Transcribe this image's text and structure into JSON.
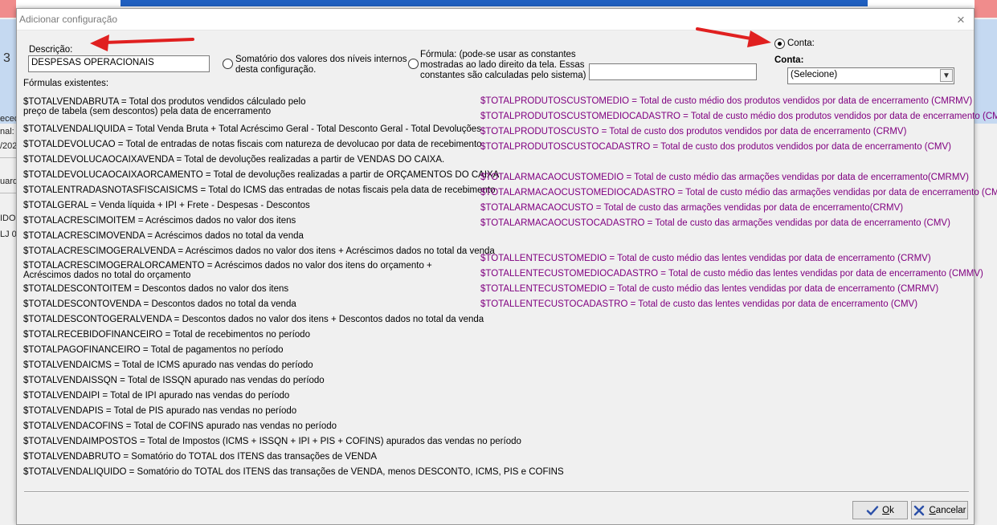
{
  "dialog": {
    "title": "Adicionar configuração",
    "close_glyph": "×"
  },
  "form": {
    "descricao_label": "Descrição:",
    "descricao_value": "DESPESAS OPERACIONAIS",
    "somatorio_label_1": "Somatório dos valores dos níveis internos",
    "somatorio_label_2": "desta configuração.",
    "formula_label_1": "Fórmula: (pode-se usar as constantes",
    "formula_label_2": "mostradas ao lado direito da tela. Essas",
    "formula_label_3": "constantes são calculadas pelo sistema)",
    "formula_value": "",
    "conta_radio_label": "Conta:",
    "conta_label": "Conta:",
    "conta_selected": "(Selecione)",
    "formulas_existentes_label": "Fórmulas existentes:"
  },
  "formulas_left": [
    "$TOTALVENDABRUTA = Total dos produtos vendidos cálculado pelo\npreço de tabela (sem descontos) pela data de encerramento",
    "$TOTALVENDALIQUIDA = Total Venda Bruta + Total Acréscimo Geral - Total Desconto Geral - Total Devoluções",
    "$TOTALDEVOLUCAO = Total de entradas de notas fiscais com natureza de devolucao por data de  recebimento",
    "$TOTALDEVOLUCAOCAIXAVENDA = Total de devoluções realizadas a partir de VENDAS DO CAIXA.",
    "$TOTALDEVOLUCAOCAIXAORCAMENTO = Total de devoluções realizadas a partir de ORÇAMENTOS DO CAIXA",
    "$TOTALENTRADASNOTASFISCAISICMS = Total do ICMS das entradas de notas fiscais pela data de recebimento",
    "$TOTALGERAL = Venda líquida + IPI + Frete - Despesas - Descontos",
    "$TOTALACRESCIMOITEM = Acréscimos dados no valor dos itens",
    "$TOTALACRESCIMOVENDA = Acréscimos dados no total da venda",
    "$TOTALACRESCIMOGERALVENDA = Acréscimos dados no valor dos itens + Acréscimos dados no total da venda",
    "$TOTALACRESCIMOGERALORCAMENTO = Acréscimos dados no valor dos itens do orçamento +\nAcréscimos dados no total do orçamento",
    "$TOTALDESCONTOITEM = Descontos dados no valor dos itens",
    "$TOTALDESCONTOVENDA = Descontos dados no total da venda",
    "$TOTALDESCONTOGERALVENDA = Descontos dados no valor dos itens + Descontos dados no total da venda",
    "$TOTALRECEBIDOFINANCEIRO = Total de recebimentos no período",
    "$TOTALPAGOFINANCEIRO = Total de pagamentos no período",
    "$TOTALVENDAICMS = Total de ICMS apurado nas vendas do período",
    "$TOTALVENDAISSQN = Total de ISSQN apurado nas vendas do período",
    "$TOTALVENDAIPI = Total de IPI apurado nas vendas do período",
    "$TOTALVENDAPIS = Total de PIS apurado nas vendas no período",
    "$TOTALVENDACOFINS = Total de COFINS apurado nas vendas no período",
    "$TOTALVENDAIMPOSTOS = Total de Impostos (ICMS + ISSQN + IPI + PIS + COFINS) apurados das vendas no período",
    "$TOTALVENDABRUTO = Somatório do TOTAL dos ITENS das transações de VENDA",
    "$TOTALVENDALIQUIDO = Somatório do TOTAL dos ITENS das transações de VENDA, menos DESCONTO, ICMS, PIS e COFINS"
  ],
  "formulas_right": [
    "$TOTALPRODUTOSCUSTOMEDIO = Total de custo médio dos produtos vendidos por data  de encerramento (CMRMV)",
    "$TOTALPRODUTOSCUSTOMEDIOCADASTRO = Total de custo médio dos produtos vendidos por data  de encerramento (CMMV)",
    "$TOTALPRODUTOSCUSTO = Total de custo dos produtos vendidos por data  de encerramento (CRMV)",
    "$TOTALPRODUTOSCUSTOCADASTRO = Total de custo dos produtos vendidos por data  de encerramento (CMV)",
    "$TOTALARMACAOCUSTOMEDIO = Total de custo médio das armações vendidas por data  de encerramento(CMRMV)",
    "$TOTALARMACAOCUSTOMEDIOCADASTRO = Total de custo médio das armações vendidas por data  de encerramento (CMMV)",
    "$TOTALARMACAOCUSTO = Total de custo das armações vendidas por data  de encerramento(CRMV)",
    "$TOTALARMACAOCUSTOCADASTRO = Total de custo das armações vendidas por data  de encerramento (CMV)",
    "$TOTALLENTECUSTOMEDIO = Total de custo médio das lentes vendidas por data  de encerramento (CRMV)",
    "$TOTALLENTECUSTOMEDIOCADASTRO = Total de custo médio das lentes vendidas por data  de encerramento (CMMV)",
    "$TOTALLENTECUSTOMEDIO = Total de custo médio das lentes vendidas por data  de encerramento (CMRMV)",
    "$TOTALLENTECUSTOCADASTRO = Total de custo das lentes vendidas por data  de encerramento (CMV)"
  ],
  "buttons": {
    "ok_label_u": "O",
    "ok_label_rest": "k",
    "cancel_label_u": "C",
    "cancel_label_rest": "ancelar"
  },
  "background": {
    "num": "3",
    "frag1": "ecedo",
    "frag2": "nal:",
    "frag3": "/202",
    "frag4": "uard",
    "frag5": "IDO",
    "frag6": "LJ 0"
  },
  "colors": {
    "right_formula_color": "#800080",
    "arrow_color": "#e02020"
  }
}
